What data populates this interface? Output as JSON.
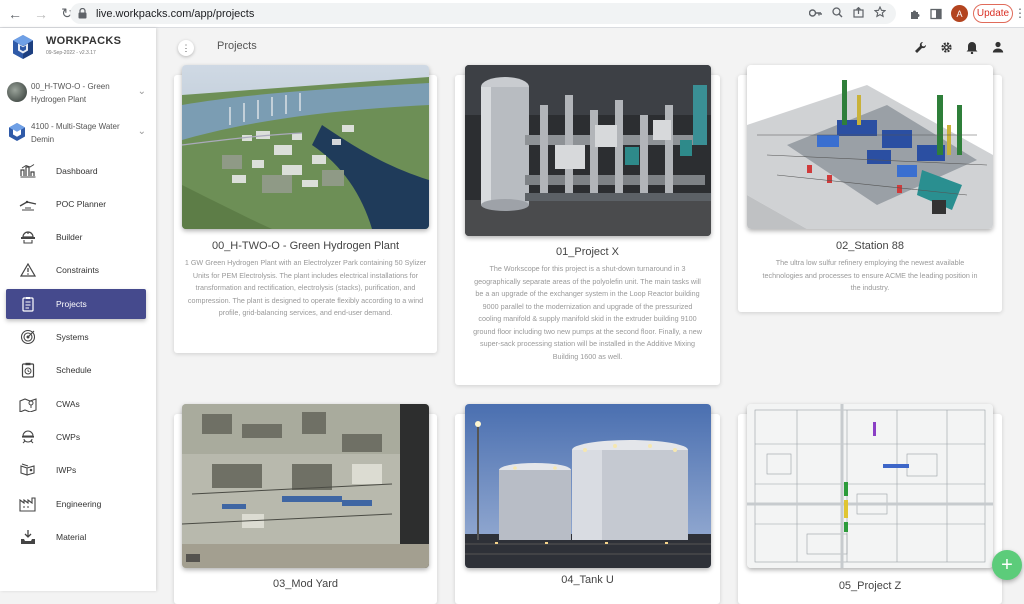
{
  "browser": {
    "url": "live.workpacks.com/app/projects",
    "avatar_letter": "A",
    "update_label": "Update"
  },
  "brand": {
    "name": "WORKPACKS",
    "version": "09-Sep-2022 - v2.3.17"
  },
  "project_selectors": [
    {
      "label": "00_H-TWO-O - Green Hydrogen Plant"
    },
    {
      "label": "4100 - Multi-Stage Water Demin"
    }
  ],
  "menu": [
    {
      "label": "Dashboard",
      "icon": "dashboard-icon"
    },
    {
      "label": "POC Planner",
      "icon": "poc-planner-icon"
    },
    {
      "label": "Builder",
      "icon": "builder-icon"
    },
    {
      "label": "Constraints",
      "icon": "constraints-icon"
    },
    {
      "label": "Projects",
      "icon": "projects-icon",
      "active": true
    },
    {
      "label": "Systems",
      "icon": "systems-icon"
    },
    {
      "label": "Schedule",
      "icon": "schedule-icon"
    },
    {
      "label": "CWAs",
      "icon": "cwas-icon"
    },
    {
      "label": "CWPs",
      "icon": "cwps-icon"
    },
    {
      "label": "IWPs",
      "icon": "iwps-icon"
    },
    {
      "label": "Engineering",
      "icon": "engineering-icon"
    },
    {
      "label": "Material",
      "icon": "material-icon"
    }
  ],
  "header": {
    "title": "Projects"
  },
  "accent": "#454a8d",
  "fab_color": "#5ccc7a",
  "projects": [
    {
      "title": "00_H-TWO-O - Green Hydrogen Plant",
      "description": "1 GW Green Hydrogen Plant with an Electrolyzer Park containing 50 Sylizer Units for PEM Electrolysis. The plant includes electrical installations for transformation and rectification, electrolysis (stacks), purification, and compression. The plant is designed to operate flexibly according to a wind profile, grid-balancing services, and end-user demand."
    },
    {
      "title": "01_Project X",
      "description": "The Workscope for this project is a shut-down turnaround in 3 geographically separate areas of the polyolefin unit. The main tasks will be a an upgrade of the exchanger system in the Loop Reactor building 9000 parallel to the modernization and upgrade of the pressurized cooling manifold & supply manifold skid in the extruder building 9100 ground floor including two new pumps at the second floor. Finally, a new super-sack processing station will be installed in the Additive Mixing Building 1600 as well."
    },
    {
      "title": "02_Station 88",
      "description": "The ultra low sulfur refinery employing the newest available technologies and processes to ensure ACME the leading position in the industry."
    },
    {
      "title": "03_Mod Yard",
      "description": ""
    },
    {
      "title": "04_Tank U",
      "description": ""
    },
    {
      "title": "05_Project Z",
      "description": ""
    }
  ]
}
